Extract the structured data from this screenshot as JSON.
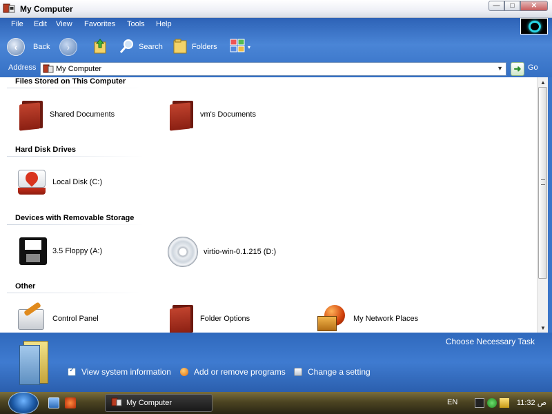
{
  "window": {
    "title": "My Computer"
  },
  "menu": {
    "items": [
      "File",
      "Edit",
      "View",
      "Favorites",
      "Tools",
      "Help"
    ]
  },
  "toolbar": {
    "back_label": "Back",
    "search_label": "Search",
    "folders_label": "Folders"
  },
  "address": {
    "label": "Address",
    "value": "My Computer",
    "go_label": "Go"
  },
  "groups": [
    {
      "title": "Files Stored on This Computer",
      "items": [
        {
          "label": "Shared Documents",
          "icon": "shared-documents-folder-icon"
        },
        {
          "label": "vm's Documents",
          "icon": "user-documents-folder-icon"
        }
      ]
    },
    {
      "title": "Hard Disk Drives",
      "items": [
        {
          "label": "Local Disk (C:)",
          "icon": "hard-disk-icon"
        }
      ]
    },
    {
      "title": "Devices with Removable Storage",
      "items": [
        {
          "label": "3.5 Floppy (A:)",
          "icon": "floppy-disk-icon"
        },
        {
          "label": "virtio-win-0.1.215 (D:)",
          "icon": "cd-drive-icon"
        }
      ]
    },
    {
      "title": "Other",
      "items": [
        {
          "label": "Control Panel",
          "icon": "control-panel-icon"
        },
        {
          "label": "Folder Options",
          "icon": "folder-options-icon"
        },
        {
          "label": "My Network Places",
          "icon": "network-places-icon"
        }
      ]
    }
  ],
  "taskpane": {
    "title": "Choose Necessary Task",
    "tasks": [
      "View system information",
      "Add or remove programs",
      "Change a setting"
    ]
  },
  "taskbar": {
    "window_button": "My Computer",
    "language": "EN",
    "clock": "11:32 ص"
  },
  "colors": {
    "chrome_blue": "#3a75c9",
    "taskbar": "#4c4422"
  }
}
